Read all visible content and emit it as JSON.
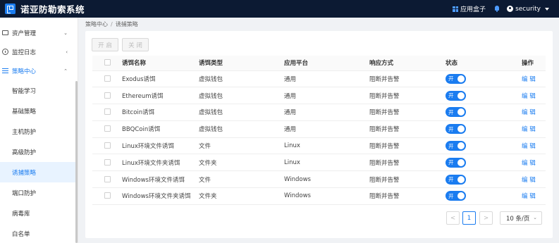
{
  "header": {
    "title": "诺亚防勒索系统",
    "app_box": "应用盒子",
    "username": "security"
  },
  "sidebar": {
    "groups": [
      {
        "label": "资产管理",
        "arrow": "⌄"
      },
      {
        "label": "监控日志",
        "arrow": "‹"
      },
      {
        "label": "策略中心",
        "arrow": "⌃"
      }
    ],
    "sub_items": [
      {
        "label": "智能学习"
      },
      {
        "label": "基础策略"
      },
      {
        "label": "主机防护"
      },
      {
        "label": "高级防护"
      },
      {
        "label": "诱捕策略"
      },
      {
        "label": "端口防护"
      },
      {
        "label": "病毒库"
      },
      {
        "label": "白名单"
      }
    ]
  },
  "breadcrumb": {
    "parent": "策略中心",
    "separator": "/",
    "current": "诱捕策略"
  },
  "toolbar": {
    "enable_label": "开 启",
    "disable_label": "关 闭"
  },
  "table": {
    "headers": [
      "诱饵名称",
      "诱饵类型",
      "应用平台",
      "响应方式",
      "状态",
      "操作"
    ],
    "rows": [
      {
        "name": "Exodus诱饵",
        "type": "虚拟钱包",
        "platform": "通用",
        "response": "阻断并告警",
        "status": "开",
        "action": "编 辑"
      },
      {
        "name": "Ethereum诱饵",
        "type": "虚拟钱包",
        "platform": "通用",
        "response": "阻断并告警",
        "status": "开",
        "action": "编 辑"
      },
      {
        "name": "Bitcoin诱饵",
        "type": "虚拟钱包",
        "platform": "通用",
        "response": "阻断并告警",
        "status": "开",
        "action": "编 辑"
      },
      {
        "name": "BBQCoin诱饵",
        "type": "虚拟钱包",
        "platform": "通用",
        "response": "阻断并告警",
        "status": "开",
        "action": "编 辑"
      },
      {
        "name": "Linux环境文件诱饵",
        "type": "文件",
        "platform": "Linux",
        "response": "阻断并告警",
        "status": "开",
        "action": "编 辑"
      },
      {
        "name": "Linux环境文件夹诱饵",
        "type": "文件夹",
        "platform": "Linux",
        "response": "阻断并告警",
        "status": "开",
        "action": "编 辑"
      },
      {
        "name": "Windows环境文件诱饵",
        "type": "文件",
        "platform": "Windows",
        "response": "阻断并告警",
        "status": "开",
        "action": "编 辑"
      },
      {
        "name": "Windows环境文件夹诱饵",
        "type": "文件夹",
        "platform": "Windows",
        "response": "阻断并告警",
        "status": "开",
        "action": "编 辑"
      }
    ]
  },
  "pagination": {
    "prev": "<",
    "current_page": "1",
    "next": ">",
    "page_size": "10 条/页"
  },
  "colors": {
    "header_bg": "#0c1a33",
    "accent": "#1a7cf0",
    "active_bg": "#e8f3ff"
  }
}
